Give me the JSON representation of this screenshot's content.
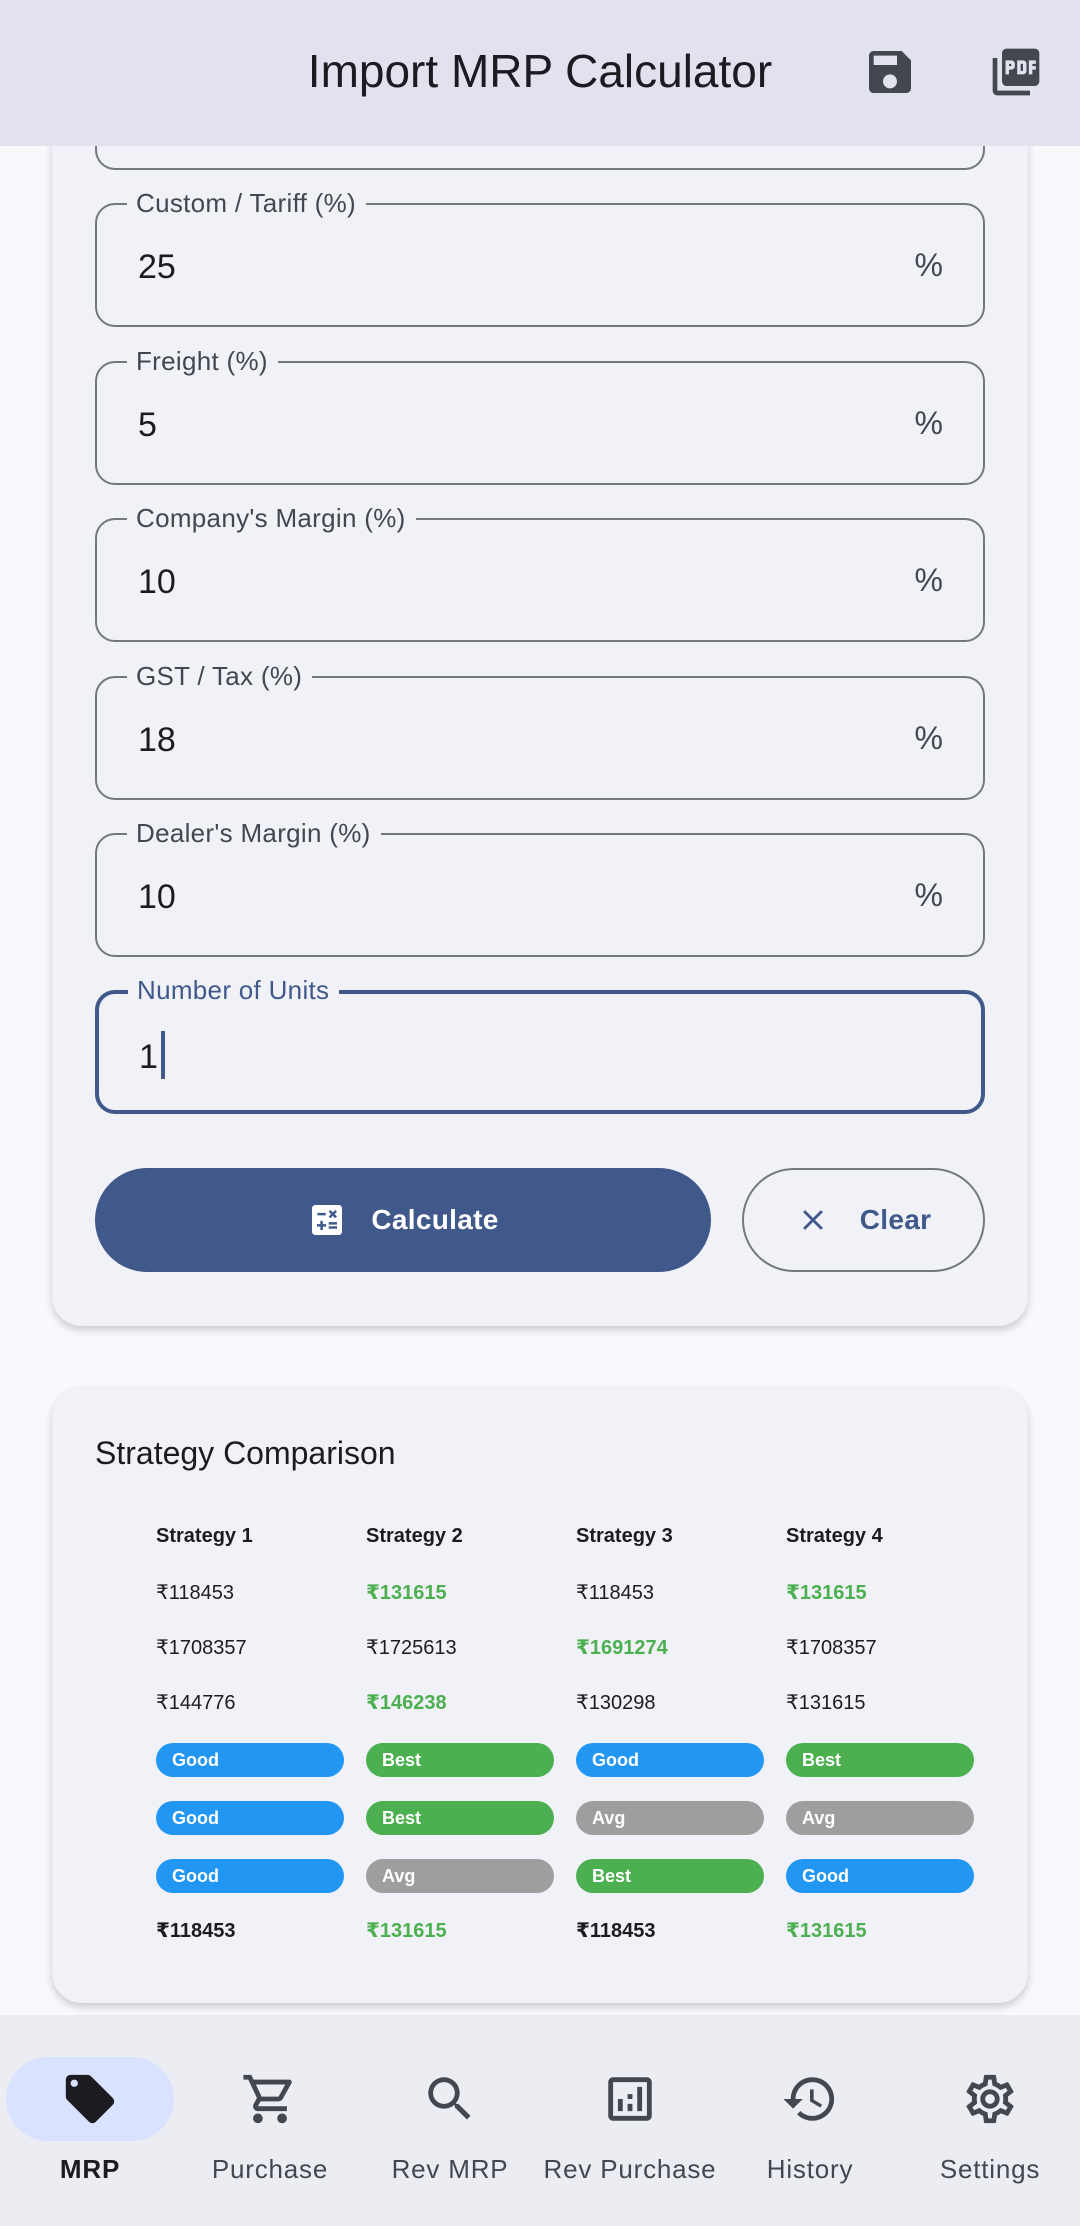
{
  "app_bar": {
    "title": "Import MRP Calculator",
    "save_icon": "floppy-disk-icon",
    "pdf_icon": "pdf-icon"
  },
  "form": {
    "fields": [
      {
        "label": "Custom / Tariff (%)",
        "value": "25",
        "suffix": "%"
      },
      {
        "label": "Freight (%)",
        "value": "5",
        "suffix": "%"
      },
      {
        "label": "Company's Margin (%)",
        "value": "10",
        "suffix": "%"
      },
      {
        "label": "GST / Tax (%)",
        "value": "18",
        "suffix": "%"
      },
      {
        "label": "Dealer's Margin (%)",
        "value": "10",
        "suffix": "%"
      }
    ],
    "units": {
      "label": "Number of Units",
      "value": "1"
    },
    "calculate_label": "Calculate",
    "clear_label": "Clear"
  },
  "strategy": {
    "title": "Strategy Comparison",
    "columns": [
      {
        "header": "Strategy 1",
        "values": [
          "₹118453",
          "₹1708357",
          "₹144776"
        ],
        "ratings": [
          "Good",
          "Good",
          "Good"
        ],
        "total": "₹118453"
      },
      {
        "header": "Strategy 2",
        "values": [
          "₹131615",
          "₹1725613",
          "₹146238"
        ],
        "ratings": [
          "Best",
          "Best",
          "Avg"
        ],
        "total": "₹131615"
      },
      {
        "header": "Strategy 3",
        "values": [
          "₹118453",
          "₹1691274",
          "₹130298"
        ],
        "ratings": [
          "Good",
          "Avg",
          "Best"
        ],
        "total": "₹118453"
      },
      {
        "header": "Strategy 4",
        "values": [
          "₹131615",
          "₹1708357",
          "₹131615"
        ],
        "ratings": [
          "Best",
          "Avg",
          "Good"
        ],
        "total": "₹131615"
      }
    ],
    "colors": {
      "good": "#2196f3",
      "best": "#4caf50",
      "avg": "#9e9e9e",
      "highlight": "#4caf50"
    }
  },
  "nav": {
    "items": [
      {
        "label": "MRP",
        "icon": "tag-icon",
        "active": true
      },
      {
        "label": "Purchase",
        "icon": "cart-icon"
      },
      {
        "label": "Rev MRP",
        "icon": "search-icon"
      },
      {
        "label": "Rev Purchase",
        "icon": "bar-chart-icon"
      },
      {
        "label": "History",
        "icon": "history-icon"
      },
      {
        "label": "Settings",
        "icon": "gear-icon"
      }
    ]
  },
  "theme": {
    "primary": "#40598a",
    "app_bar_bg": "#e1e2ee",
    "active_nav_bg": "#d9e2ff"
  }
}
